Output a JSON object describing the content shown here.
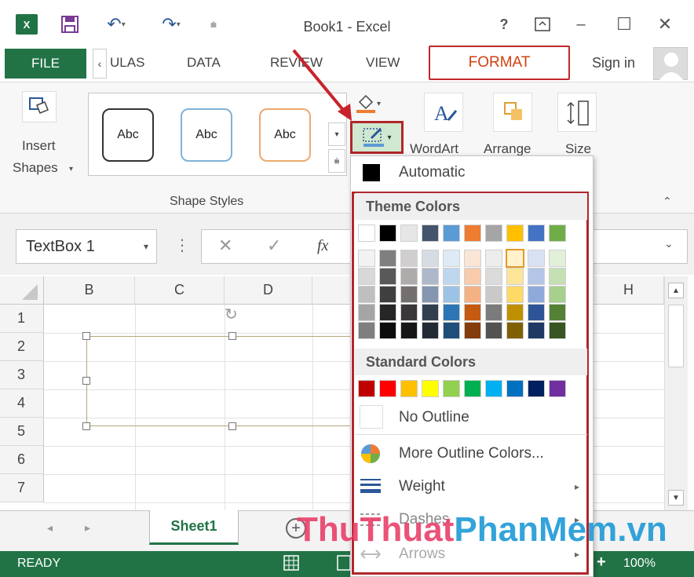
{
  "window": {
    "title": "Book1 - Excel",
    "help": "?",
    "minimize": "–",
    "maximize": "☐",
    "close": "✕"
  },
  "tabs": {
    "file": "FILE",
    "formulas": "ULAS",
    "data": "DATA",
    "review": "REVIEW",
    "view": "VIEW",
    "format": "FORMAT",
    "sign_in": "Sign in",
    "scroll_left": "‹"
  },
  "ribbon": {
    "insert_shapes_line1": "Insert",
    "insert_shapes_line2": "Shapes",
    "styles": [
      "Abc",
      "Abc",
      "Abc"
    ],
    "group_label": "Shape Styles",
    "wordart": "WordArt",
    "arrange": "Arrange",
    "size": "Size"
  },
  "formula_bar": {
    "name_box": "TextBox 1",
    "cancel": "✕",
    "enter": "✓",
    "fx": "fx"
  },
  "grid": {
    "columns": [
      "B",
      "C",
      "D",
      "H"
    ],
    "rows": [
      "1",
      "2",
      "3",
      "4",
      "5",
      "6",
      "7"
    ]
  },
  "sheet": {
    "tab": "Sheet1",
    "add": "+"
  },
  "status": {
    "ready": "READY",
    "zoom": "100%",
    "zoom_plus": "+"
  },
  "dropdown": {
    "automatic": "Automatic",
    "theme_colors_label": "Theme Colors",
    "standard_colors_label": "Standard Colors",
    "no_outline": "No Outline",
    "more_colors": "More Outline Colors...",
    "weight": "Weight",
    "dashes": "Dashes",
    "arrows": "Arrows",
    "theme_top": [
      "#ffffff",
      "#000000",
      "#e7e6e6",
      "#44546a",
      "#5b9bd5",
      "#ed7d31",
      "#a5a5a5",
      "#ffc000",
      "#4472c4",
      "#70ad47"
    ],
    "theme_shades": [
      [
        "#f2f2f2",
        "#7f7f7f",
        "#d0cece",
        "#d6dce4",
        "#deebf6",
        "#fbe5d5",
        "#ededed",
        "#fff2cc",
        "#d9e2f3",
        "#e2efd9"
      ],
      [
        "#d8d8d8",
        "#595959",
        "#aeabab",
        "#adb9ca",
        "#bdd7ee",
        "#f7cbac",
        "#dbdbdb",
        "#fee599",
        "#b4c6e7",
        "#c5e0b3"
      ],
      [
        "#bfbfbf",
        "#3f3f3f",
        "#757070",
        "#8496b0",
        "#9cc3e5",
        "#f4b183",
        "#c9c9c9",
        "#ffd965",
        "#8eaadb",
        "#a8d08d"
      ],
      [
        "#a5a5a5",
        "#262626",
        "#3a3838",
        "#323f4f",
        "#2e75b5",
        "#c55a11",
        "#7b7b7b",
        "#bf9000",
        "#2f5496",
        "#538135"
      ],
      [
        "#7f7f7f",
        "#0c0c0c",
        "#171616",
        "#222a35",
        "#1e4e79",
        "#833c0b",
        "#525252",
        "#7f6000",
        "#1f3864",
        "#375623"
      ]
    ],
    "standard": [
      "#c00000",
      "#ff0000",
      "#ffc000",
      "#ffff00",
      "#92d050",
      "#00b050",
      "#00b0f0",
      "#0070c0",
      "#002060",
      "#7030a0"
    ]
  },
  "watermark": {
    "part1": "ThuThuat",
    "part2": "PhanMem",
    "part3": ".vn"
  },
  "accent": {
    "excel_green": "#217346",
    "highlight_red": "#c0282d"
  }
}
